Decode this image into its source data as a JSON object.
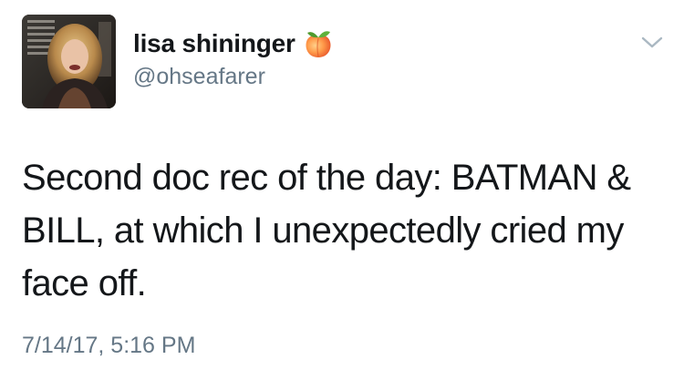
{
  "user": {
    "display_name": "lisa shininger",
    "handle": "@ohseafarer",
    "name_emoji": "peach-emoji"
  },
  "tweet": {
    "text": "Second doc rec of the day: BATMAN &\nBILL, at which I unexpectedly cried my\nface off.",
    "timestamp": "7/14/17, 5:16 PM"
  },
  "icons": {
    "menu": "chevron-down-icon"
  },
  "colors": {
    "text_primary": "#14171a",
    "text_secondary": "#657786",
    "caret": "#aab8c2"
  }
}
